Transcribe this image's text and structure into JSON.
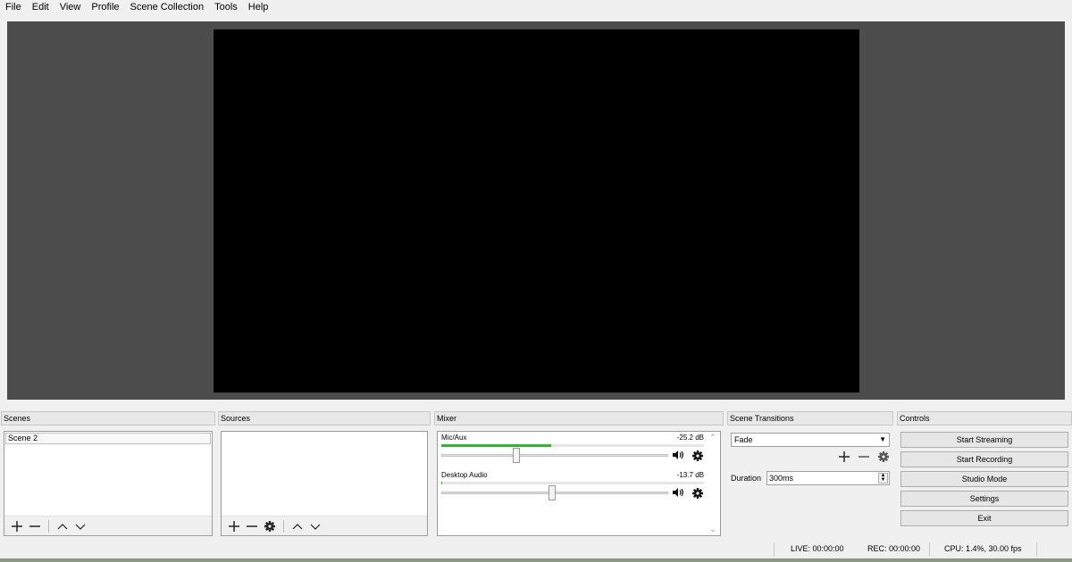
{
  "menu": [
    "File",
    "Edit",
    "View",
    "Profile",
    "Scene Collection",
    "Tools",
    "Help"
  ],
  "scenes": {
    "title": "Scenes",
    "items": [
      "Scene 2"
    ]
  },
  "sources": {
    "title": "Sources"
  },
  "mixer": {
    "title": "Mixer",
    "channels": [
      {
        "name": "Mic/Aux",
        "db": "-25.2 dB",
        "level": 0.42,
        "volume": 0.33
      },
      {
        "name": "Desktop Audio",
        "db": "-13.7 dB",
        "level": 0.0,
        "volume": 0.49
      }
    ]
  },
  "transitions": {
    "title": "Scene Transitions",
    "selected": "Fade",
    "duration_label": "Duration",
    "duration_value": "300ms"
  },
  "controls": {
    "title": "Controls",
    "start_streaming": "Start Streaming",
    "start_recording": "Start Recording",
    "studio_mode": "Studio Mode",
    "settings": "Settings",
    "exit": "Exit"
  },
  "status": {
    "live": "LIVE: 00:00:00",
    "rec": "REC: 00:00:00",
    "cpu": "CPU: 1.4%, 30.00 fps"
  },
  "colors": {
    "preview_bg": "#4c4c4c",
    "canvas": "#000000",
    "meter": "#33b233"
  }
}
